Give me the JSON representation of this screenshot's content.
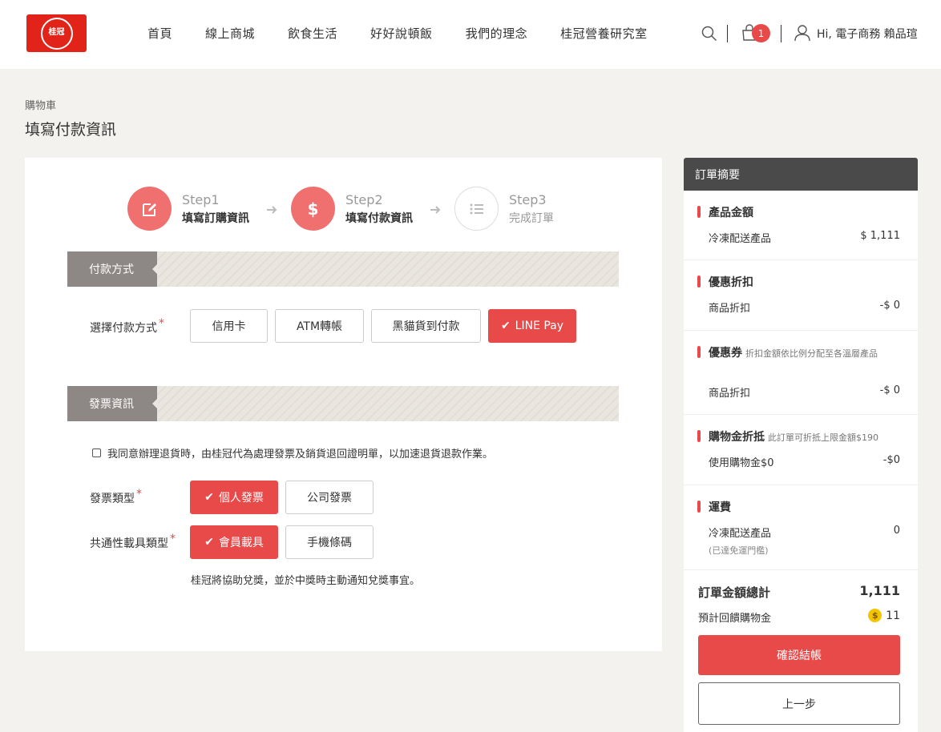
{
  "brand": {
    "logo_text": "桂冠"
  },
  "nav": [
    "首頁",
    "線上商城",
    "飲食生活",
    "好好說頓飯",
    "我們的理念",
    "桂冠營養研究室"
  ],
  "header": {
    "cart_count": "1",
    "greeting": "Hi, 電子商務 賴品瑄"
  },
  "breadcrumb": "購物車",
  "page_title": "填寫付款資訊",
  "steps": [
    {
      "num": "Step1",
      "label": "填寫訂購資訊",
      "state": "done"
    },
    {
      "num": "Step2",
      "label": "填寫付款資訊",
      "state": "active"
    },
    {
      "num": "Step3",
      "label": "完成訂單",
      "state": "pending"
    }
  ],
  "payment": {
    "section_title": "付款方式",
    "label": "選擇付款方式",
    "required_mark": "*",
    "options": [
      "信用卡",
      "ATM轉帳",
      "黑貓貨到付款",
      "LINE Pay"
    ],
    "selected": "LINE Pay"
  },
  "invoice": {
    "section_title": "發票資訊",
    "agree_text": "我同意辦理退貨時，由桂冠代為處理發票及銷貨退回證明單，以加速退貨退款作業。",
    "type_label": "發票類型",
    "type_options": [
      "個人發票",
      "公司發票"
    ],
    "type_selected": "個人發票",
    "carrier_label": "共通性載具類型",
    "carrier_options": [
      "會員載具",
      "手機條碼"
    ],
    "carrier_selected": "會員載具",
    "note": "桂冠將協助兌獎，並於中獎時主動通知兌獎事宜。"
  },
  "summary": {
    "title": "訂單摘要",
    "product": {
      "title": "產品金額",
      "row_label": "冷凍配送產品",
      "row_value": "$ 1,111"
    },
    "discount": {
      "title": "優惠折扣",
      "row_label": "商品折扣",
      "row_value": "-$ 0"
    },
    "coupon": {
      "title": "優惠券",
      "subtitle": "折扣金額依比例分配至各溫層產品",
      "row_label": "商品折扣",
      "row_value": "-$ 0"
    },
    "credit": {
      "title": "購物金折抵",
      "subtitle": "此訂單可折抵上限金額$190",
      "row_label": "使用購物金$0",
      "row_value": "-$0"
    },
    "shipping": {
      "title": "運費",
      "row_label": "冷凍配送產品",
      "row_value": "0",
      "note": "(已達免運門檻)"
    },
    "total_label": "訂單金額總計",
    "total_value": "1,111",
    "bonus_label": "預計回饋購物金",
    "bonus_coin": "$",
    "bonus_value": "11",
    "checkout_label": "確認結帳",
    "back_label": "上一步"
  },
  "colors": {
    "accent": "#e84a4a",
    "step_active": "#f07070",
    "section_tag": "#8d8785",
    "summary_head": "#4a4a4a"
  }
}
